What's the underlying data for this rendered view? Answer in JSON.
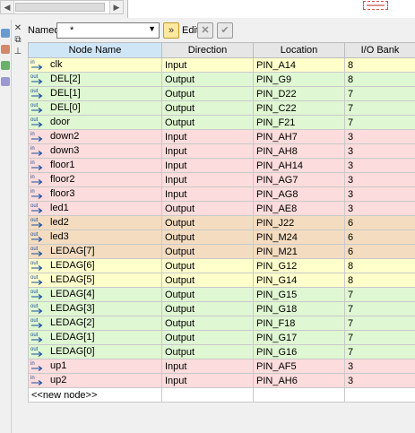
{
  "toolbar": {
    "named_label": "Named:",
    "named_value": "*",
    "edit_label": "Edit:",
    "double_arrow_icon": "»"
  },
  "columns": [
    "Node Name",
    "Direction",
    "Location",
    "I/O Bank"
  ],
  "rows": [
    {
      "name": "clk",
      "direction": "Input",
      "location": "PIN_A14",
      "bank": "8",
      "kind": "in",
      "color": "clk"
    },
    {
      "name": "DEL[2]",
      "direction": "Output",
      "location": "PIN_G9",
      "bank": "8",
      "kind": "out",
      "color": "out"
    },
    {
      "name": "DEL[1]",
      "direction": "Output",
      "location": "PIN_D22",
      "bank": "7",
      "kind": "out",
      "color": "out"
    },
    {
      "name": "DEL[0]",
      "direction": "Output",
      "location": "PIN_C22",
      "bank": "7",
      "kind": "out",
      "color": "out"
    },
    {
      "name": "door",
      "direction": "Output",
      "location": "PIN_F21",
      "bank": "7",
      "kind": "out",
      "color": "out"
    },
    {
      "name": "down2",
      "direction": "Input",
      "location": "PIN_AH7",
      "bank": "3",
      "kind": "in",
      "color": "in"
    },
    {
      "name": "down3",
      "direction": "Input",
      "location": "PIN_AH8",
      "bank": "3",
      "kind": "in",
      "color": "in"
    },
    {
      "name": "floor1",
      "direction": "Input",
      "location": "PIN_AH14",
      "bank": "3",
      "kind": "in",
      "color": "in"
    },
    {
      "name": "floor2",
      "direction": "Input",
      "location": "PIN_AG7",
      "bank": "3",
      "kind": "in",
      "color": "in"
    },
    {
      "name": "floor3",
      "direction": "Input",
      "location": "PIN_AG8",
      "bank": "3",
      "kind": "in",
      "color": "in"
    },
    {
      "name": "led1",
      "direction": "Output",
      "location": "PIN_AE8",
      "bank": "3",
      "kind": "out",
      "color": "in"
    },
    {
      "name": "led2",
      "direction": "Output",
      "location": "PIN_J22",
      "bank": "6",
      "kind": "out",
      "color": "tan"
    },
    {
      "name": "led3",
      "direction": "Output",
      "location": "PIN_M24",
      "bank": "6",
      "kind": "out",
      "color": "tan"
    },
    {
      "name": "LEDAG[7]",
      "direction": "Output",
      "location": "PIN_M21",
      "bank": "6",
      "kind": "out",
      "color": "tan"
    },
    {
      "name": "LEDAG[6]",
      "direction": "Output",
      "location": "PIN_G12",
      "bank": "8",
      "kind": "out",
      "color": "yel"
    },
    {
      "name": "LEDAG[5]",
      "direction": "Output",
      "location": "PIN_G14",
      "bank": "8",
      "kind": "out",
      "color": "yel"
    },
    {
      "name": "LEDAG[4]",
      "direction": "Output",
      "location": "PIN_G15",
      "bank": "7",
      "kind": "out",
      "color": "out"
    },
    {
      "name": "LEDAG[3]",
      "direction": "Output",
      "location": "PIN_G18",
      "bank": "7",
      "kind": "out",
      "color": "out"
    },
    {
      "name": "LEDAG[2]",
      "direction": "Output",
      "location": "PIN_F18",
      "bank": "7",
      "kind": "out",
      "color": "out"
    },
    {
      "name": "LEDAG[1]",
      "direction": "Output",
      "location": "PIN_G17",
      "bank": "7",
      "kind": "out",
      "color": "out"
    },
    {
      "name": "LEDAG[0]",
      "direction": "Output",
      "location": "PIN_G16",
      "bank": "7",
      "kind": "out",
      "color": "out"
    },
    {
      "name": "up1",
      "direction": "Input",
      "location": "PIN_AF5",
      "bank": "3",
      "kind": "in",
      "color": "in"
    },
    {
      "name": "up2",
      "direction": "Input",
      "location": "PIN_AH6",
      "bank": "3",
      "kind": "in",
      "color": "in"
    }
  ],
  "new_node_label": "<<new node>>",
  "colors": {
    "input_row": "#fcdcdc",
    "output_row": "#dff7d2",
    "yellow_row": "#ffffcc",
    "tan_row": "#f4dcc0",
    "sorted_header": "#cfe6f7"
  }
}
